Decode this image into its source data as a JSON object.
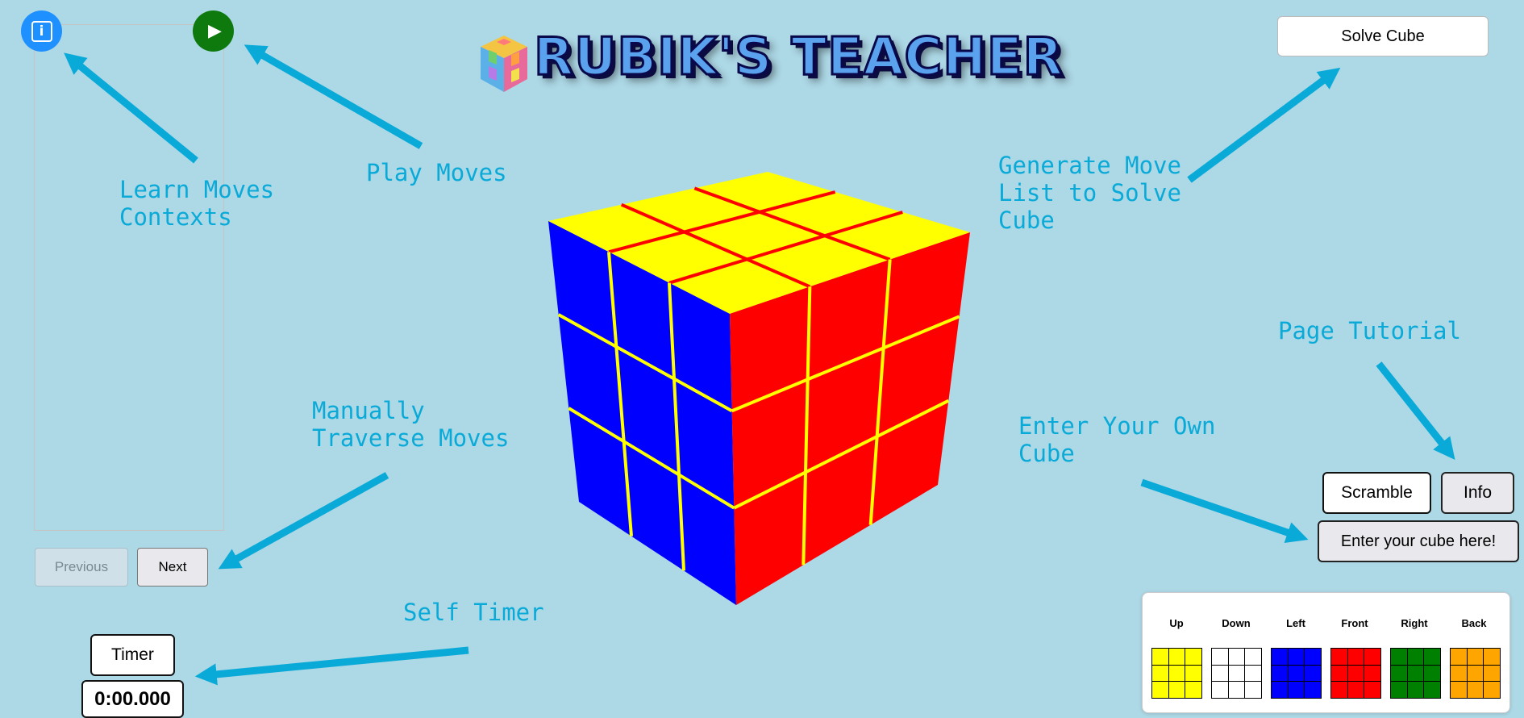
{
  "header": {
    "title": "RUBIK'S TEACHER",
    "logo_icon": "cube-logo-icon"
  },
  "toolbar": {
    "info_icon_glyph": "i",
    "play_icon_glyph": "▶",
    "solve_label": "Solve Cube",
    "scramble_label": "Scramble",
    "info_label": "Info",
    "enter_cube_label": "Enter your cube here!"
  },
  "nav": {
    "previous_label": "Previous",
    "next_label": "Next"
  },
  "timer": {
    "button_label": "Timer",
    "display": "0:00.000"
  },
  "tutorial": {
    "learn": "Learn Moves\nContexts",
    "play": "Play Moves",
    "generate": "Generate Move\nList to Solve\nCube",
    "page_tutorial": "Page Tutorial",
    "manual": "Manually\nTraverse Moves",
    "enter": "Enter Your Own\nCube",
    "self_timer": "Self Timer"
  },
  "colors": {
    "background": "#add8e6",
    "arrow": "#0aaad8",
    "yellow": "#ffff00",
    "white": "#ffffff",
    "blue": "#0000ff",
    "red": "#ff0000",
    "green": "#008000",
    "orange": "#ffa500"
  },
  "cube_faces": [
    {
      "label": "Up",
      "color": "#ffff00"
    },
    {
      "label": "Down",
      "color": "#ffffff"
    },
    {
      "label": "Left",
      "color": "#0000ff"
    },
    {
      "label": "Front",
      "color": "#ff0000"
    },
    {
      "label": "Right",
      "color": "#008000"
    },
    {
      "label": "Back",
      "color": "#ffa500"
    }
  ]
}
